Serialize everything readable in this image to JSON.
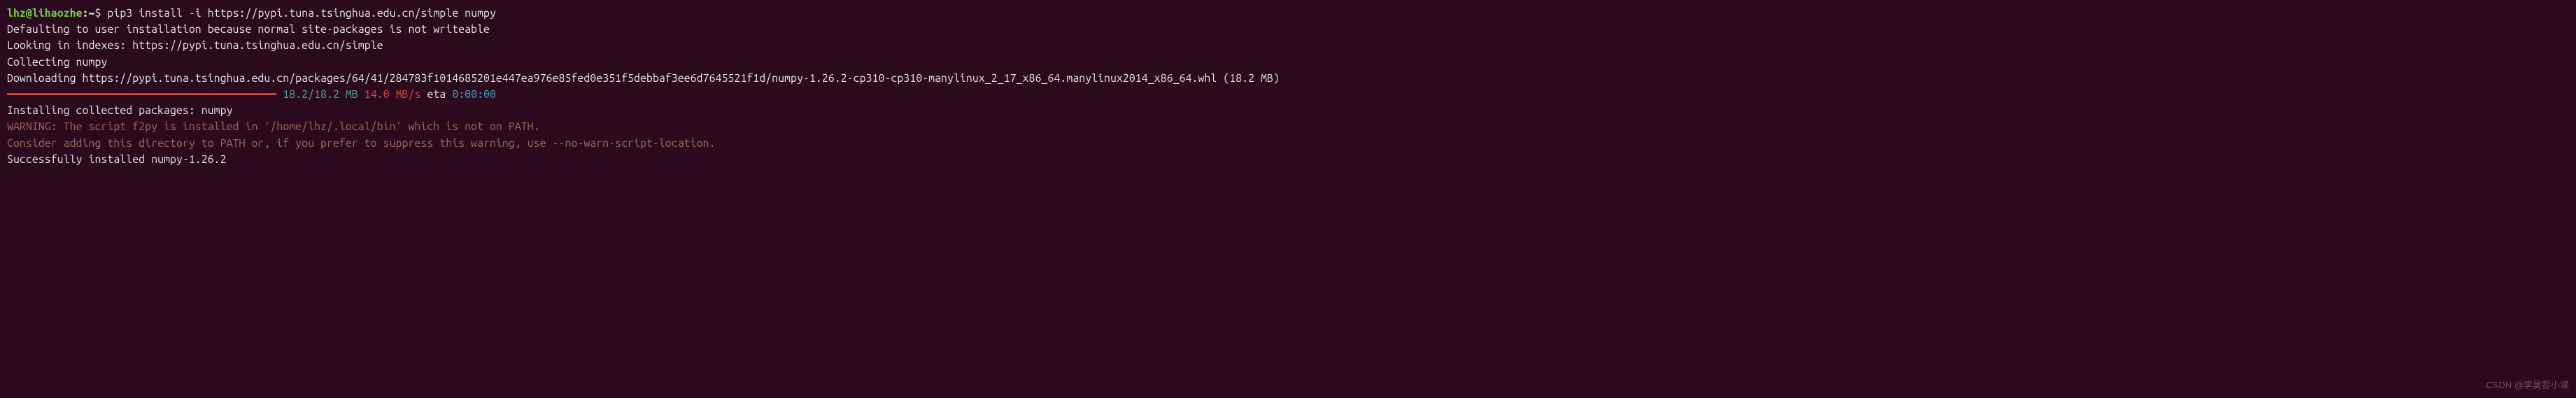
{
  "prompt": {
    "user": "lhz",
    "host": "lihaozhe",
    "path": "~",
    "symbol": "$",
    "command": "pip3 install -i https://pypi.tuna.tsinghua.edu.cn/simple numpy"
  },
  "output": {
    "line1": "Defaulting to user installation because normal site-packages is not writeable",
    "line2": "Looking in indexes: https://pypi.tuna.tsinghua.edu.cn/simple",
    "line3": "Collecting numpy",
    "line4": "  Downloading https://pypi.tuna.tsinghua.edu.cn/packages/64/41/284783f1014685201e447ea976e85fed0e351f5debbaf3ee6d7645521f1d/numpy-1.26.2-cp310-cp310-manylinux_2_17_x86_64.manylinux2014_x86_64.whl (18.2 MB)"
  },
  "progress": {
    "indent": "     ",
    "bar": "━━━━━━━━━━━━━━━━━━━━━━━━━━━━━━━━━━━━━━━━",
    "size": "18.2/18.2 MB",
    "speed": "14.0 MB/s",
    "eta_label": "eta",
    "eta_time": "0:00:00"
  },
  "install": {
    "line1": "Installing collected packages: numpy",
    "warning1": "  WARNING: The script f2py is installed in '/home/lhz/.local/bin' which is not on PATH.",
    "warning2": "  Consider adding this directory to PATH or, if you prefer to suppress this warning, use --no-warn-script-location.",
    "success": "Successfully installed numpy-1.26.2"
  },
  "watermark": "CSDN @李昊哲小课"
}
